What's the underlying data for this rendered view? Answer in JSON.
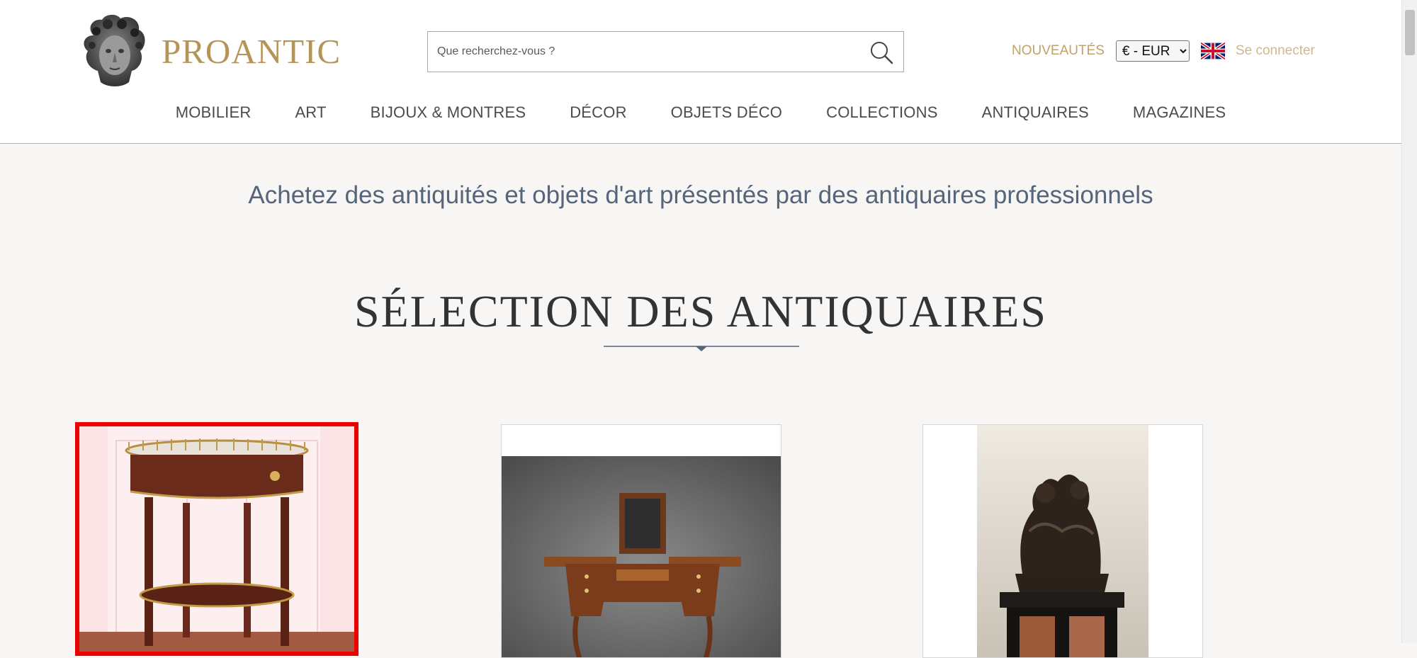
{
  "header": {
    "logo_text": "PROANTIC",
    "search": {
      "placeholder": "Que recherchez-vous ?",
      "value": ""
    },
    "new_label": "NOUVEAUTÉS",
    "currency": {
      "selected": "€ - EUR"
    },
    "flag": "uk-flag-icon",
    "login_label": "Se connecter"
  },
  "nav": {
    "items": [
      {
        "label": "MOBILIER"
      },
      {
        "label": "ART"
      },
      {
        "label": "BIJOUX & MONTRES"
      },
      {
        "label": "DÉCOR"
      },
      {
        "label": "OBJETS DÉCO"
      },
      {
        "label": "COLLECTIONS"
      },
      {
        "label": "ANTIQUAIRES"
      },
      {
        "label": "MAGAZINES"
      }
    ]
  },
  "main": {
    "tagline": "Achetez des antiquités et objets d'art présentés par des antiquaires professionnels",
    "section_title": "SÉLECTION DES ANTIQUAIRES"
  },
  "colors": {
    "gold": "#b49457",
    "nav_text": "#4b4b4b",
    "tagline": "#56657a",
    "selection_outline": "#ee0000"
  }
}
